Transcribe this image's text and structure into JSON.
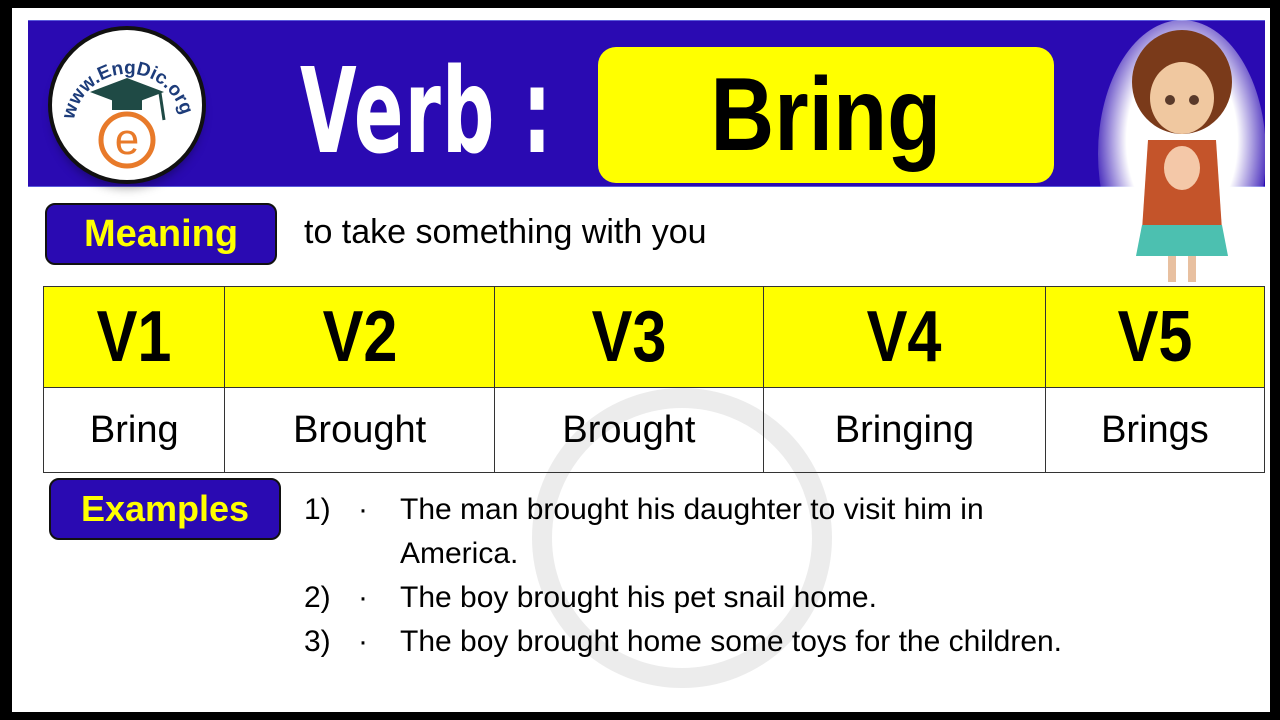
{
  "logo": {
    "text": "www.EngDic.org",
    "letter": "e"
  },
  "header": {
    "label": "Verb :",
    "verb": "Bring"
  },
  "meaning": {
    "label": "Meaning",
    "text": "to take something with you"
  },
  "forms_table": {
    "headers": [
      "V1",
      "V2",
      "V3",
      "V4",
      "V5"
    ],
    "values": [
      "Bring",
      "Brought",
      "Brought",
      "Bringing",
      "Brings"
    ]
  },
  "examples": {
    "label": "Examples",
    "items": [
      {
        "num": "1)",
        "bullet": "·",
        "text": "The man brought his daughter to visit him in America."
      },
      {
        "num": "2)",
        "bullet": "·",
        "text": "The boy brought his pet snail home."
      },
      {
        "num": "3)",
        "bullet": "·",
        "text": "The boy brought home some toys for the children."
      }
    ]
  },
  "colors": {
    "banner": "#2a0ab2",
    "highlight": "#ffff00",
    "frame": "#000000"
  }
}
